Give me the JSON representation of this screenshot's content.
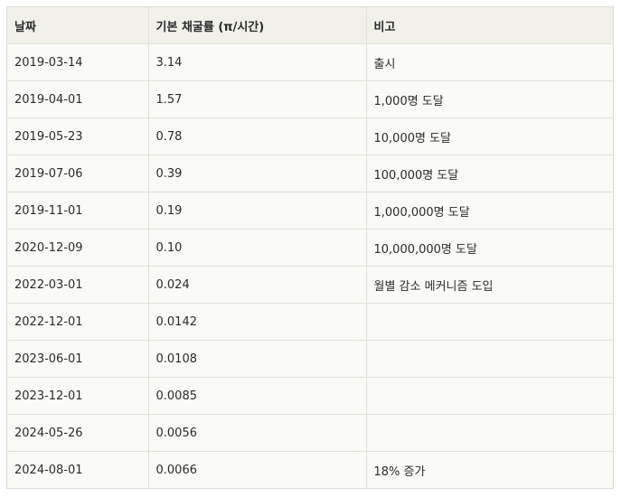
{
  "table": {
    "headers": [
      "날짜",
      "기본 채굴률 (π/시간)",
      "비고"
    ],
    "rows": [
      [
        "2019-03-14",
        "3.14",
        "출시"
      ],
      [
        "2019-04-01",
        "1.57",
        "1,000명 도달"
      ],
      [
        "2019-05-23",
        "0.78",
        "10,000명 도달"
      ],
      [
        "2019-07-06",
        "0.39",
        "100,000명 도달"
      ],
      [
        "2019-11-01",
        "0.19",
        "1,000,000명 도달"
      ],
      [
        "2020-12-09",
        "0.10",
        "10,000,000명 도달"
      ],
      [
        "2022-03-01",
        "0.024",
        "월별 감소 메커니즘 도입"
      ],
      [
        "2022-12-01",
        "0.0142",
        ""
      ],
      [
        "2023-06-01",
        "0.0108",
        ""
      ],
      [
        "2023-12-01",
        "0.0085",
        ""
      ],
      [
        "2024-05-26",
        "0.0056",
        ""
      ],
      [
        "2024-08-01",
        "0.0066",
        "18% 증가"
      ]
    ]
  }
}
